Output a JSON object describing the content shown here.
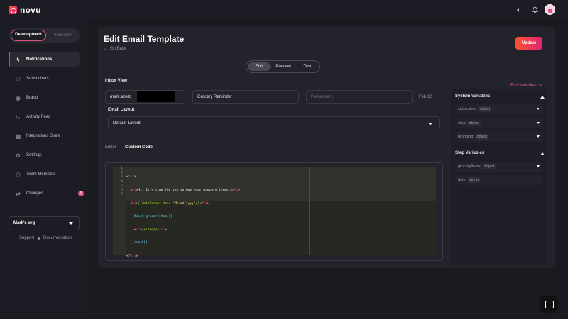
{
  "app": {
    "name": "novu"
  },
  "topbar": {
    "theme_icon": "theme-toggle-icon",
    "bell_icon": "bell-icon"
  },
  "sidebar": {
    "env": {
      "dev": "Development",
      "prod": "Production"
    },
    "items": [
      {
        "label": "Notifications",
        "icon": "lightning-icon"
      },
      {
        "label": "Subscribers",
        "icon": "users-icon"
      },
      {
        "label": "Brand",
        "icon": "brand-icon"
      },
      {
        "label": "Activity Feed",
        "icon": "activity-icon"
      },
      {
        "label": "Integrations Store",
        "icon": "integrations-icon"
      },
      {
        "label": "Settings",
        "icon": "gear-icon"
      },
      {
        "label": "Team Members",
        "icon": "team-icon"
      },
      {
        "label": "Changes",
        "icon": "changes-icon",
        "badge": "6"
      }
    ],
    "org": "Mark's org",
    "support": "Support",
    "documentation": "Documentation"
  },
  "main": {
    "title": "Edit Email Template",
    "go_back": "Go Back",
    "update": "Update",
    "segments": [
      "Edit",
      "Preview",
      "Test"
    ],
    "inbox_view_label": "Inbox View",
    "sender_value": "mark.abeto",
    "subject_value": "Grocery Reminder",
    "preheader_placeholder": "Preheader...",
    "date": "Feb 10",
    "email_layout_label": "Email Layout",
    "email_layout_value": "Default Layout",
    "tabs": [
      "Editor",
      "Custom Code"
    ],
    "code_lines": [
      "1",
      "2",
      "3",
      "4",
      "5",
      "6",
      "7"
    ],
    "code": {
      "l1_tag": "div",
      "l2_tag": "h1",
      "l2_text": "Hi, It's time for you to buy your grocery items.",
      "l3_tag": "h2",
      "l3_hbs": "{{dateFormat date ",
      "l3_str": "\"MM/dd/yyyy\"",
      "l3_end": "}}",
      "l4": "{{#each groceryItems}}",
      "l5_tag": "li",
      "l5_hbs": "{{item}}",
      "l6": "{{/each}}",
      "l7_tag": "div"
    }
  },
  "variables": {
    "edit_label": "Edit Variables",
    "system_title": "System Variables",
    "system": [
      {
        "name": "subscriber:",
        "type": "object"
      },
      {
        "name": "step:",
        "type": "object"
      },
      {
        "name": "branding:",
        "type": "object"
      }
    ],
    "step_title": "Step Variables",
    "step": [
      {
        "name": "groceryItems:",
        "type": "object"
      },
      {
        "name": "date:",
        "type": "string"
      }
    ]
  }
}
